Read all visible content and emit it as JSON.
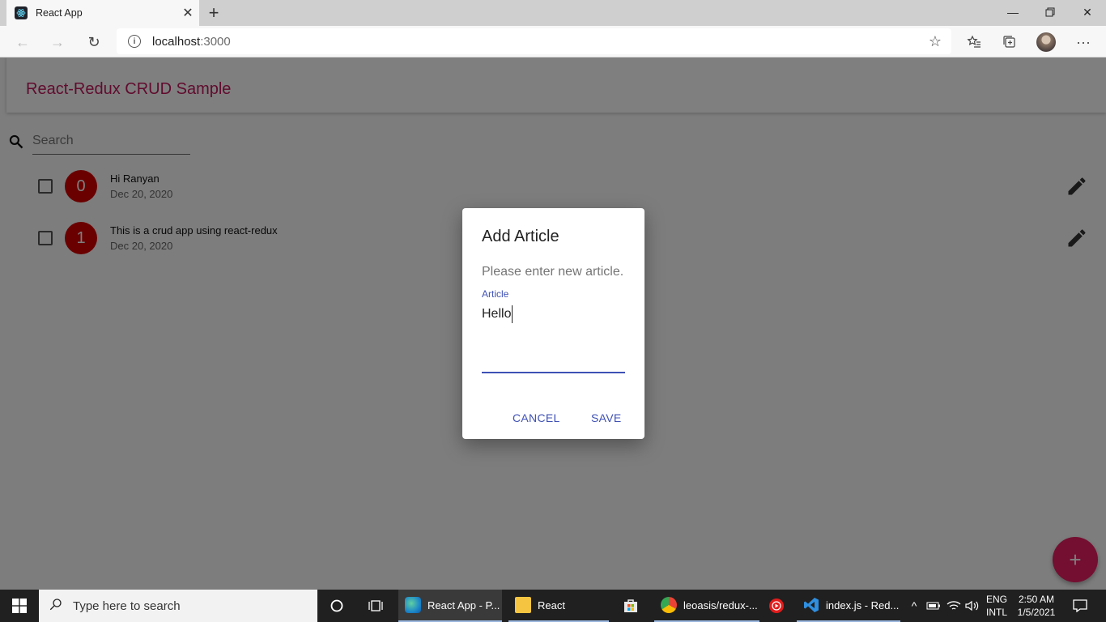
{
  "browser": {
    "tab_title": "React App",
    "url_host": "localhost",
    "url_port": ":3000"
  },
  "app": {
    "title": "React-Redux CRUD Sample",
    "search_placeholder": "Search",
    "articles": [
      {
        "index": "0",
        "title": "Hi Ranyan",
        "date": "Dec 20, 2020"
      },
      {
        "index": "1",
        "title": "This is a crud app using react-redux",
        "date": "Dec 20, 2020"
      }
    ],
    "fab_label": "+"
  },
  "dialog": {
    "title": "Add Article",
    "text": "Please enter new article.",
    "field_label": "Article",
    "field_value": "Hello",
    "cancel_label": "CANCEL",
    "save_label": "SAVE"
  },
  "taskbar": {
    "search_placeholder": "Type here to search",
    "apps": [
      {
        "label": "React App - P..."
      },
      {
        "label": "React"
      },
      {
        "label": "leoasis/redux-..."
      },
      {
        "label": "index.js - Red..."
      }
    ],
    "lang_top": "ENG",
    "lang_bottom": "INTL",
    "time": "2:50 AM",
    "date": "1/5/2021"
  },
  "colors": {
    "accent": "#c2185b",
    "primary": "#3f51b5",
    "badge": "#d50000",
    "fab": "#e91e63"
  }
}
